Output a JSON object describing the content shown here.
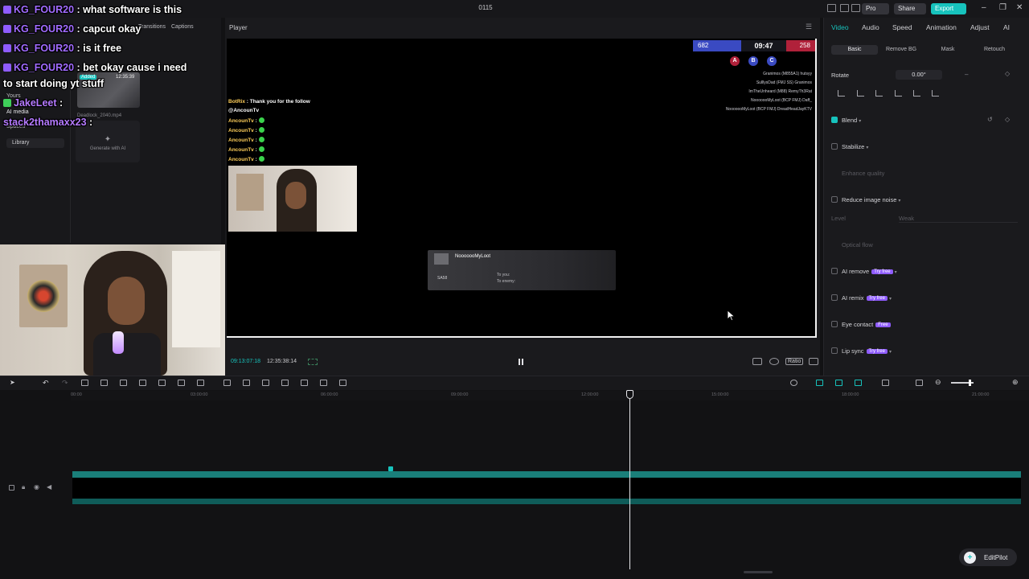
{
  "app": {
    "project_title": "0115",
    "pro_label": "Pro",
    "share_label": "Share",
    "export_label": "Export"
  },
  "left_panel": {
    "toolbar_tabs": [
      "Transitions",
      "Captions"
    ],
    "nav_items": [
      "Yours",
      "AI media",
      "Spaces"
    ],
    "library_label": "Library",
    "media_added": "Added",
    "media_duration": "12:35:39",
    "media_filename": "Deadlock_2040.mp4",
    "generate_label": "Generate with AI"
  },
  "chat_overlay": [
    {
      "user": "KG_FOUR20",
      "message": " : what software is this"
    },
    {
      "user": "KG_FOUR20",
      "message": " : capcut okay"
    },
    {
      "user": "KG_FOUR20",
      "message": " : is it free"
    },
    {
      "user": "KG_FOUR20",
      "message": " : bet okay cause i need"
    },
    {
      "user": "",
      "message": "to start doing yt stuff"
    },
    {
      "user": "JakeLeet",
      "message": " :"
    },
    {
      "user": "stack2thamaxx23",
      "message": " :"
    }
  ],
  "player": {
    "title": "Player",
    "score_left": "682",
    "match_time": "09:47",
    "score_right": "258",
    "objectives": [
      "A",
      "B",
      "C"
    ],
    "killfeed": [
      "Granimos (M855A1) hutsyy",
      "SulllysDad (FMJ SS) Granimos",
      "ImTheUnheard (M88) RemyTh3Rat",
      "NooooooMyLoot (BCP FMJ) Daff_",
      "NooooooMyLoot (BCP FMJ) DreadHeadJayKTV"
    ],
    "ingame_chat": {
      "first_user": "BotRix",
      "first_message": " : Thank you for the follow",
      "second_line": "@AncounTv",
      "repeat_user": "AncounTv"
    },
    "kill_card": {
      "name": "NooooooMyLoot",
      "weapon": "SA58",
      "stats_to_you": "To you:",
      "stats_to_enemy": "To enemy:"
    },
    "timecode_current": "09:13:07:18",
    "timecode_total": "12:35:38:14",
    "ratio_label": "Ratio"
  },
  "right_panel": {
    "tabs": [
      "Video",
      "Audio",
      "Speed",
      "Animation",
      "Adjust",
      "AI"
    ],
    "subtabs": [
      "Basic",
      "Remove BG",
      "Mask",
      "Retouch"
    ],
    "rotate_label": "Rotate",
    "rotate_value": "0.00°",
    "props": [
      {
        "label": "Blend",
        "checked": true,
        "tag": ""
      },
      {
        "label": "Stabilize",
        "checked": false,
        "tag": ""
      },
      {
        "label": "Enhance quality",
        "checked": false,
        "tag": "",
        "muted": true
      },
      {
        "label": "Reduce image noise",
        "checked": false,
        "tag": ""
      },
      {
        "label": "Level",
        "checked": false,
        "tag": "",
        "muted": true,
        "value": "Weak"
      },
      {
        "label": "Optical flow",
        "checked": false,
        "tag": "",
        "muted": true
      },
      {
        "label": "AI remove",
        "checked": false,
        "tag": "Try free"
      },
      {
        "label": "AI remix",
        "checked": false,
        "tag": "Try free"
      },
      {
        "label": "Eye contact",
        "checked": false,
        "tag": "Free"
      },
      {
        "label": "Lip sync",
        "checked": false,
        "tag": "Try free"
      }
    ]
  },
  "timeline": {
    "ruler_ticks": [
      "00:00",
      "03:00:00",
      "06:00:00",
      "09:00:00",
      "12:00:00",
      "15:00:00",
      "18:00:00",
      "21:00:00"
    ]
  },
  "editpilot_label": "EditPilot"
}
